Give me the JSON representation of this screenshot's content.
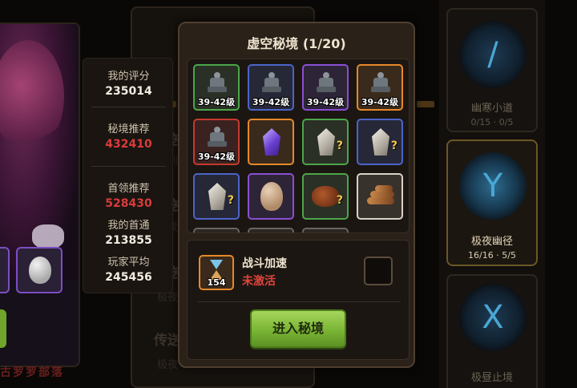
{
  "dialog": {
    "title": "虚空秘境 (1/20)"
  },
  "reward_grid": {
    "items": [
      {
        "icon": "statue-icon",
        "level": "39-42级",
        "rarity": "green"
      },
      {
        "icon": "statue-icon",
        "level": "39-42级",
        "rarity": "blue"
      },
      {
        "icon": "statue-icon",
        "level": "39-42级",
        "rarity": "purple"
      },
      {
        "icon": "statue-icon",
        "level": "39-42级",
        "rarity": "orange"
      },
      {
        "icon": "statue-icon",
        "level": "39-42级",
        "rarity": "red"
      },
      {
        "icon": "violet-crystal-icon",
        "rarity": "orange"
      },
      {
        "icon": "silver-crystal-icon",
        "rarity": "green",
        "mystery": "?"
      },
      {
        "icon": "silver-crystal-icon",
        "rarity": "blue",
        "mystery": "?"
      },
      {
        "icon": "silver-crystal-icon",
        "rarity": "blue",
        "mystery": "?"
      },
      {
        "icon": "egg-icon",
        "rarity": "purple"
      },
      {
        "icon": "meat-icon",
        "rarity": "green",
        "mystery": "?"
      },
      {
        "icon": "logs-icon",
        "rarity": "white"
      }
    ]
  },
  "boost": {
    "title": "战斗加速",
    "status": "未激活",
    "count": "154",
    "icon": "hourglass-icon"
  },
  "enter_button": {
    "label": "进入秘境",
    "color": "#7ab535"
  },
  "stats_panel": {
    "my_score_label": "我的评分",
    "my_score": "235014",
    "recommended_label": "秘境推荐",
    "recommended": "432410",
    "boss_recommended_label": "首领推荐",
    "boss_recommended": "528430",
    "my_first_clear_label": "我的首通",
    "my_first_clear": "213855",
    "player_average_label": "玩家平均",
    "player_average": "245456"
  },
  "background": {
    "mid_entries": [
      {
        "title": "传送",
        "sub": "级别"
      },
      {
        "title": "传送",
        "sub": "极夜"
      },
      {
        "title": "传送",
        "sub": "极夜"
      },
      {
        "title": "传送",
        "sub": "极夜"
      }
    ],
    "left_caption": "古罗罗部落",
    "portals": [
      {
        "name": "幽寒小道",
        "count_a": "0/15",
        "count_b": "0/5",
        "selected": false
      },
      {
        "name": "极夜幽径",
        "count_a": "16/16",
        "count_b": "5/5",
        "selected": true
      },
      {
        "name": "极昼止境",
        "count_a": "",
        "count_b": "",
        "selected": false
      }
    ]
  },
  "colors": {
    "accent_red": "#d93b3b",
    "dialog_bg": "#2a2119",
    "rarity_green": "#4ba64a",
    "rarity_blue": "#4b64c8",
    "rarity_purple": "#8a4ed3",
    "rarity_orange": "#e6892a",
    "rarity_red": "#c63a2e"
  }
}
